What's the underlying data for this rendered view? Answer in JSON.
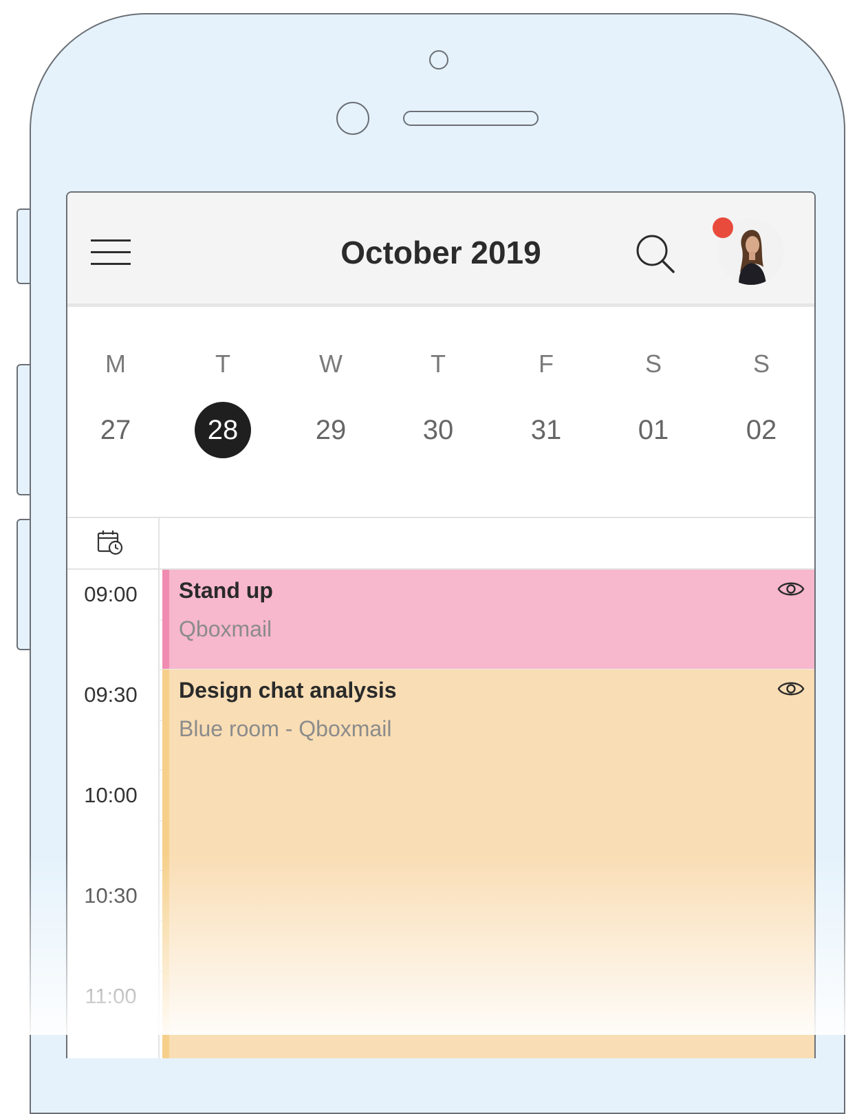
{
  "header": {
    "title": "October 2019"
  },
  "week": {
    "days": [
      {
        "letter": "M",
        "num": "27"
      },
      {
        "letter": "T",
        "num": "28"
      },
      {
        "letter": "W",
        "num": "29"
      },
      {
        "letter": "T",
        "num": "30"
      },
      {
        "letter": "F",
        "num": "31"
      },
      {
        "letter": "S",
        "num": "01"
      },
      {
        "letter": "S",
        "num": "02"
      }
    ],
    "selected_num": "28"
  },
  "times": [
    "09:00",
    "09:30",
    "10:00",
    "10:30",
    "11:00"
  ],
  "events": [
    {
      "title": "Stand up",
      "subtitle": "Qboxmail",
      "color": "#f7b7cd",
      "accent": "#f08bb1"
    },
    {
      "title": "Design chat analysis",
      "subtitle": "Blue room - Qboxmail",
      "color": "#f9ddb4",
      "accent": "#f6cf8a"
    }
  ],
  "icons": {
    "menu": "menu-icon",
    "search": "search-icon",
    "avatar": "user-avatar",
    "allday": "calendar-clock-icon",
    "visibility": "eye-icon"
  },
  "colors": {
    "notification": "#e84b3c",
    "phone_bg": "#e5f2fb",
    "selected_day": "#1f1f1f"
  }
}
